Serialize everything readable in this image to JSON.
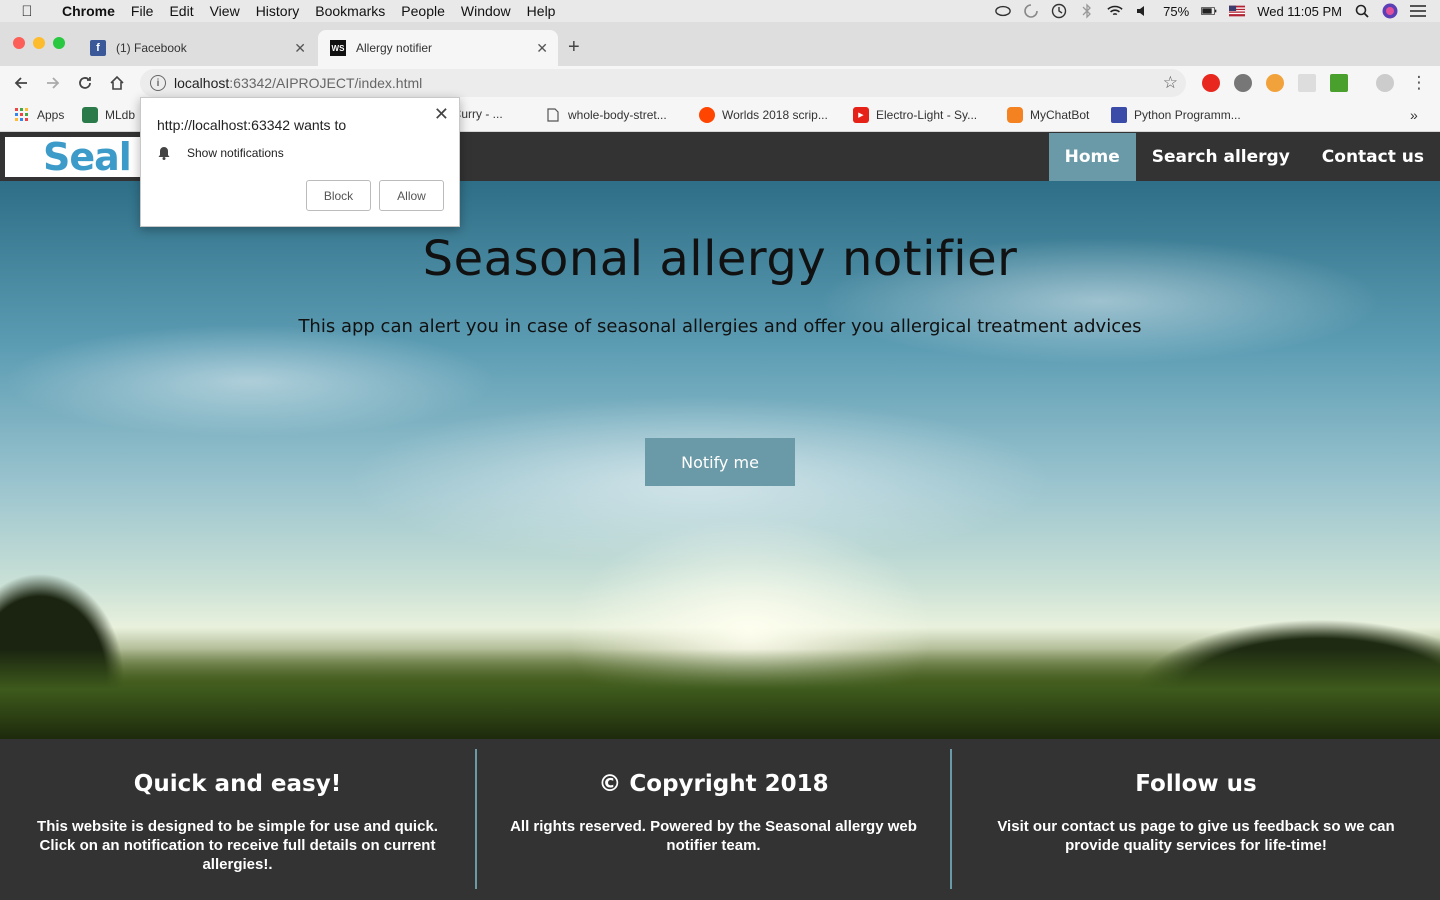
{
  "menubar": {
    "app_name": "Chrome",
    "items": [
      "File",
      "Edit",
      "View",
      "History",
      "Bookmarks",
      "People",
      "Window",
      "Help"
    ],
    "battery": "75%",
    "clock": "Wed 11:05 PM"
  },
  "tabs": [
    {
      "title": "(1) Facebook",
      "favicon": "facebook-icon",
      "active": false
    },
    {
      "title": "Allergy notifier",
      "favicon": "webstorm-icon",
      "favicon_text": "WS",
      "active": true
    }
  ],
  "address_bar": {
    "host": "localhost",
    "path": ":63342/AIPROJECT/index.html"
  },
  "bookmarks": [
    {
      "label": "Apps",
      "icon": "apps-grid-icon"
    },
    {
      "label": "MLdb",
      "icon": "mldb-icon"
    },
    {
      "label": "el Curry - ...",
      "icon": "page-icon"
    },
    {
      "label": "whole-body-stret...",
      "icon": "page-icon"
    },
    {
      "label": "Worlds 2018 scrip...",
      "icon": "reddit-icon"
    },
    {
      "label": "Electro-Light - Sy...",
      "icon": "youtube-icon"
    },
    {
      "label": "MyChatBot",
      "icon": "chatbot-icon"
    },
    {
      "label": "Python Programm...",
      "icon": "python-icon"
    }
  ],
  "bookmarks_overflow": "»",
  "permission_popup": {
    "title": "http://localhost:63342 wants to",
    "permission": "Show notifications",
    "block_label": "Block",
    "allow_label": "Allow"
  },
  "site": {
    "logo_text": "Seal",
    "nav": [
      "Home",
      "Search allergy",
      "Contact us"
    ],
    "active_nav": "Home",
    "hero_title": "Seasonal allergy notifier",
    "hero_subtitle": "This app can alert you in case of seasonal allergies and offer you allergical treatment advices",
    "cta_label": "Notify me",
    "footer": [
      {
        "heading": "Quick and easy!",
        "text": "This website is designed to be simple for use and quick. Click on an notification to receive full details on current allergies!."
      },
      {
        "heading": "© Copyright 2018",
        "text": "All rights reserved. Powered by the Seasonal allergy web notifier team."
      },
      {
        "heading": "Follow us",
        "text": "Visit our contact us page to give us feedback so we can provide quality services for life-time!"
      }
    ]
  },
  "colors": {
    "accent": "#6a9aa7",
    "dark_bar": "#333333",
    "logo_blue": "#3d9bc9"
  }
}
